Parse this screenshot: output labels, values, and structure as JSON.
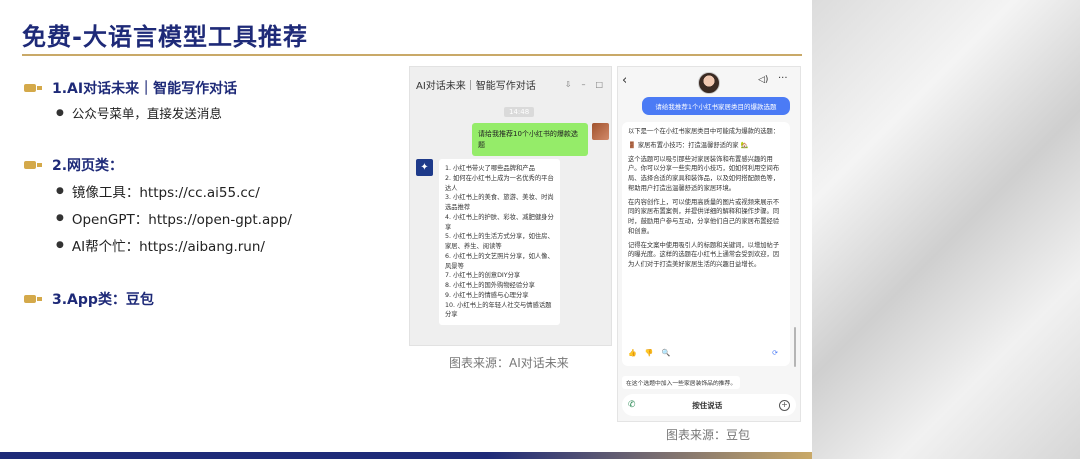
{
  "title": "免费-大语言模型工具推荐",
  "sections": [
    {
      "label": "1.AI对话未来｜智能写作对话",
      "bullets": [
        "公众号菜单，直接发送消息"
      ]
    },
    {
      "label": "2.网页类：",
      "bullets": [
        "镜像工具：https://cc.ai55.cc/",
        "OpenGPT：https://open-gpt.app/",
        "AI帮个忙：https://aibang.run/"
      ]
    },
    {
      "label": "3.App类：豆包",
      "bullets": []
    }
  ],
  "left_shot": {
    "header_title": "AI对话未来｜智能写作对话",
    "window_controls": [
      "⇩",
      "–",
      "□"
    ],
    "timestamp": "14:48",
    "user_message": "请给我推荐10个小红书的爆款选题",
    "ai_avatar_glyph": "✦",
    "ai_reply": [
      "1. 小红书带火了哪些品牌和产品",
      "2. 如何在小红书上成为一名优秀的平台达人",
      "3. 小红书上的美食、旅游、美妆、时尚选品推荐",
      "4. 小红书上的护肤、彩妆、减肥健身分享",
      "5. 小红书上的生活方式分享，如住房、家居、养生、阅读等",
      "6. 小红书上的文艺照片分享，如人像、风景等",
      "7. 小红书上的创意DIY分享",
      "8. 小红书上的国外购物经验分享",
      "9. 小红书上的情感与心理分享",
      "10. 小红书上的年轻人社交与情感话题分享"
    ],
    "caption": "图表来源：AI对话未来"
  },
  "right_shot": {
    "back_icon": "‹",
    "speaker_icon": "◁)",
    "more_icon": "···",
    "question": "请给我推荐1个小红书家居类目的爆款选题",
    "answer_paragraphs": [
      "以下是一个在小红书家居类目中可能成为爆款的选题：",
      "🚪 家居布置小技巧：打造温馨舒适的家 🏡",
      "这个选题可以吸引那些对家居装饰和布置感兴趣的用户。你可以分享一些实用的小技巧，如如何利用空间布局、选择合适的家具和装饰品，以及如何搭配颜色等，帮助用户打造出温馨舒适的家居环境。",
      "在内容创作上，可以使用高质量的图片或视频来展示不同的家居布置案例，并提供详细的解释和操作步骤。同时，鼓励用户参与互动，分享他们自己的家居布置经验和创意。",
      "记得在文案中使用吸引人的标题和关键词，以增加帖子的曝光度。这样的选题在小红书上通常会受到欢迎，因为人们对于打造美好家居生活的兴趣日益增长。"
    ],
    "actions": [
      "👍",
      "👎",
      "🔍"
    ],
    "refresh_icon": "⟳",
    "suggestion": "在这个选题中加入一些家居装饰品的推荐。",
    "phone_icon": "✆",
    "hold_to_talk": "按住说话",
    "plus_icon": "+",
    "caption": "图表来源：豆包"
  }
}
